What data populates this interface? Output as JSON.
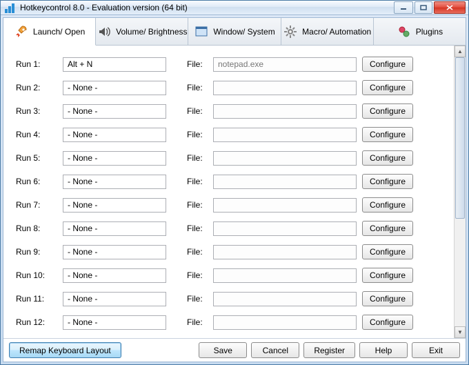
{
  "window": {
    "title": "Hotkeycontrol 8.0 - Evaluation version (64 bit)"
  },
  "tabs": [
    {
      "label": "Launch/ Open",
      "icon": "rocket-icon",
      "active": true
    },
    {
      "label": "Volume/ Brightness",
      "icon": "speaker-icon",
      "active": false
    },
    {
      "label": "Window/ System",
      "icon": "window-icon",
      "active": false
    },
    {
      "label": "Macro/ Automation",
      "icon": "gear-icon",
      "active": false
    },
    {
      "label": "Plugins",
      "icon": "plugin-icon",
      "active": false
    }
  ],
  "rows": [
    {
      "label": "Run 1:",
      "hotkey": "Alt + N",
      "file_label": "File:",
      "file": "notepad.exe",
      "configure": "Configure"
    },
    {
      "label": "Run 2:",
      "hotkey": "- None -",
      "file_label": "File:",
      "file": "",
      "configure": "Configure"
    },
    {
      "label": "Run 3:",
      "hotkey": "- None -",
      "file_label": "File:",
      "file": "",
      "configure": "Configure"
    },
    {
      "label": "Run 4:",
      "hotkey": "- None -",
      "file_label": "File:",
      "file": "",
      "configure": "Configure"
    },
    {
      "label": "Run 5:",
      "hotkey": "- None -",
      "file_label": "File:",
      "file": "",
      "configure": "Configure"
    },
    {
      "label": "Run 6:",
      "hotkey": "- None -",
      "file_label": "File:",
      "file": "",
      "configure": "Configure"
    },
    {
      "label": "Run 7:",
      "hotkey": "- None -",
      "file_label": "File:",
      "file": "",
      "configure": "Configure"
    },
    {
      "label": "Run 8:",
      "hotkey": "- None -",
      "file_label": "File:",
      "file": "",
      "configure": "Configure"
    },
    {
      "label": "Run 9:",
      "hotkey": "- None -",
      "file_label": "File:",
      "file": "",
      "configure": "Configure"
    },
    {
      "label": "Run 10:",
      "hotkey": "- None -",
      "file_label": "File:",
      "file": "",
      "configure": "Configure"
    },
    {
      "label": "Run 11:",
      "hotkey": "- None -",
      "file_label": "File:",
      "file": "",
      "configure": "Configure"
    },
    {
      "label": "Run 12:",
      "hotkey": "- None -",
      "file_label": "File:",
      "file": "",
      "configure": "Configure"
    }
  ],
  "buttons": {
    "remap": "Remap Keyboard Layout",
    "save": "Save",
    "cancel": "Cancel",
    "register": "Register",
    "help": "Help",
    "exit": "Exit"
  }
}
